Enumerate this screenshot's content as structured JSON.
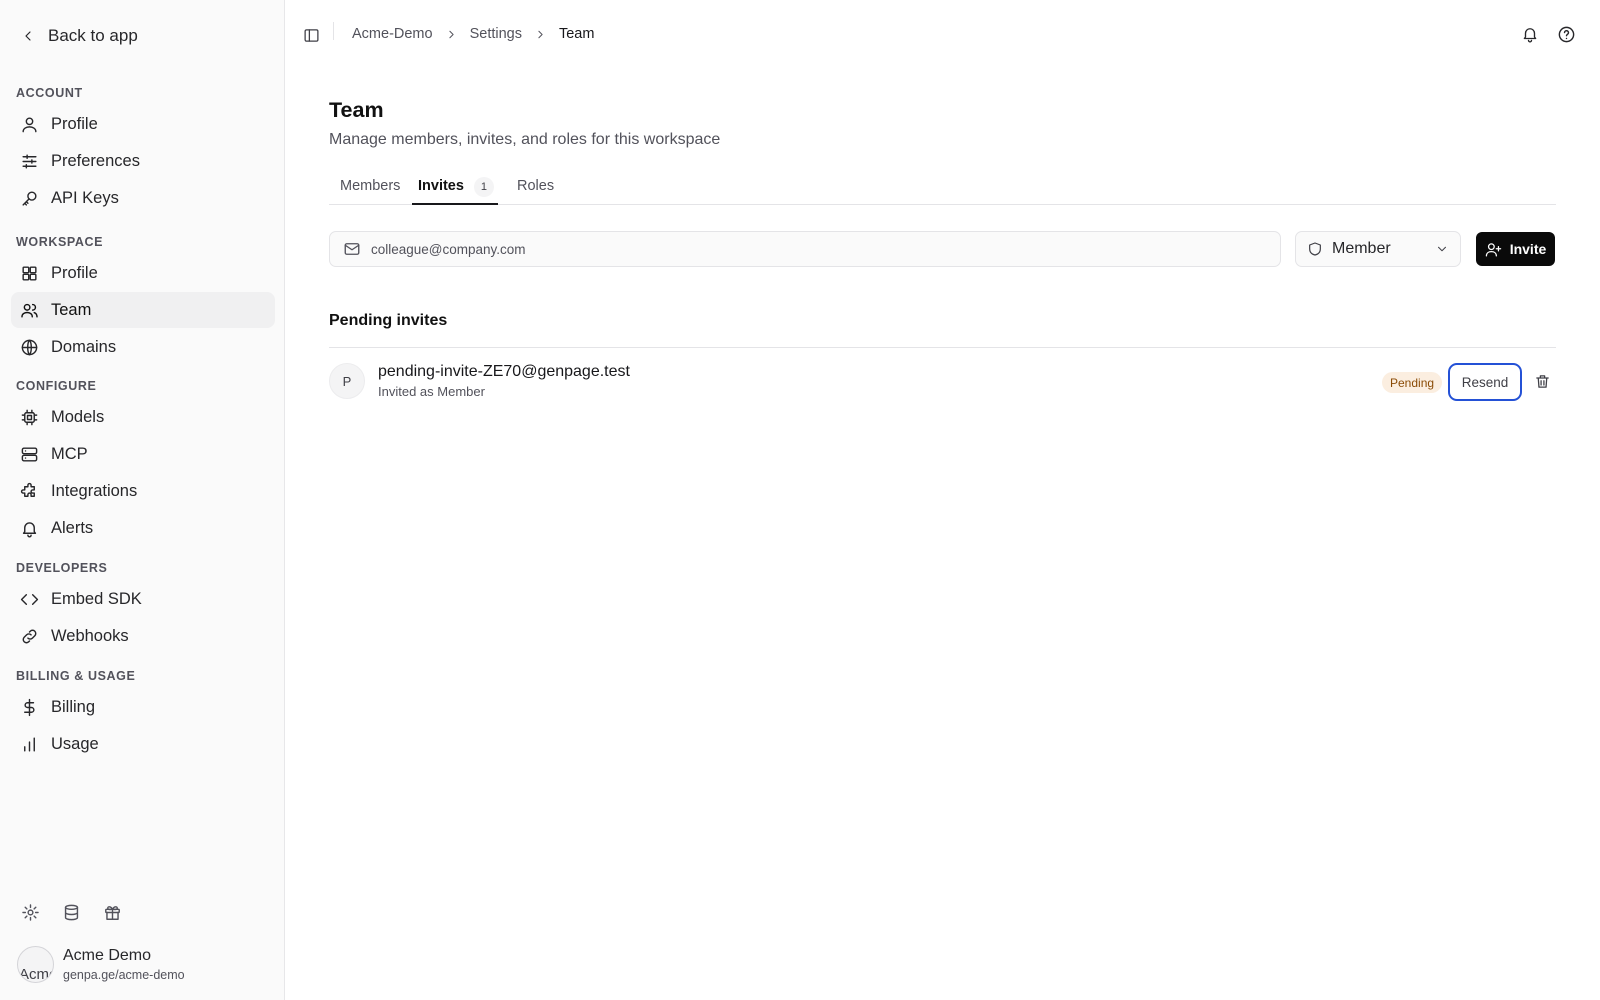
{
  "sidebar": {
    "back_label": "Back to app",
    "sections": {
      "account": "ACCOUNT",
      "workspace": "WORKSPACE",
      "configure": "CONFIGURE",
      "developers": "DEVELOPERS",
      "billing": "BILLING & USAGE"
    },
    "items": {
      "account_profile": "Profile",
      "preferences": "Preferences",
      "api_keys": "API Keys",
      "workspace_profile": "Profile",
      "team": "Team",
      "domains": "Domains",
      "models": "Models",
      "mcp": "MCP",
      "integrations": "Integrations",
      "alerts": "Alerts",
      "embed_sdk": "Embed SDK",
      "webhooks": "Webhooks",
      "billing": "Billing",
      "usage": "Usage"
    },
    "active_item": "team",
    "footer_icons": [
      "gear-icon",
      "database-icon",
      "gift-icon"
    ],
    "account": {
      "avatar_alt": "Acme",
      "name": "Acme Demo",
      "url": "genpa.ge/acme-demo"
    }
  },
  "topbar": {
    "breadcrumb": [
      "Acme-Demo",
      "Settings",
      "Team"
    ],
    "icons": [
      "sidebar-toggle-icon",
      "bell-icon",
      "help-icon"
    ]
  },
  "page": {
    "title": "Team",
    "subtitle": "Manage members, invites, and roles for this workspace"
  },
  "tabs": [
    {
      "label": "Members"
    },
    {
      "label": "Invites",
      "count": "1",
      "active": true
    },
    {
      "label": "Roles"
    }
  ],
  "invite_form": {
    "email_placeholder": "colleague@company.com",
    "email_value": "",
    "role_value": "Member",
    "submit_label": "Invite"
  },
  "pending": {
    "heading": "Pending invites",
    "invites": [
      {
        "initial": "P",
        "email": "pending-invite-ZE70@genpage.test",
        "role_text": "Invited as Member",
        "status": "Pending",
        "resend_label": "Resend"
      }
    ]
  },
  "colors": {
    "accent": "#0a0a0a",
    "focus_ring": "#2451d6",
    "pending_badge_bg": "#fbeee0",
    "pending_badge_text": "#8a4b06",
    "sidebar_bg": "#fafafa"
  }
}
